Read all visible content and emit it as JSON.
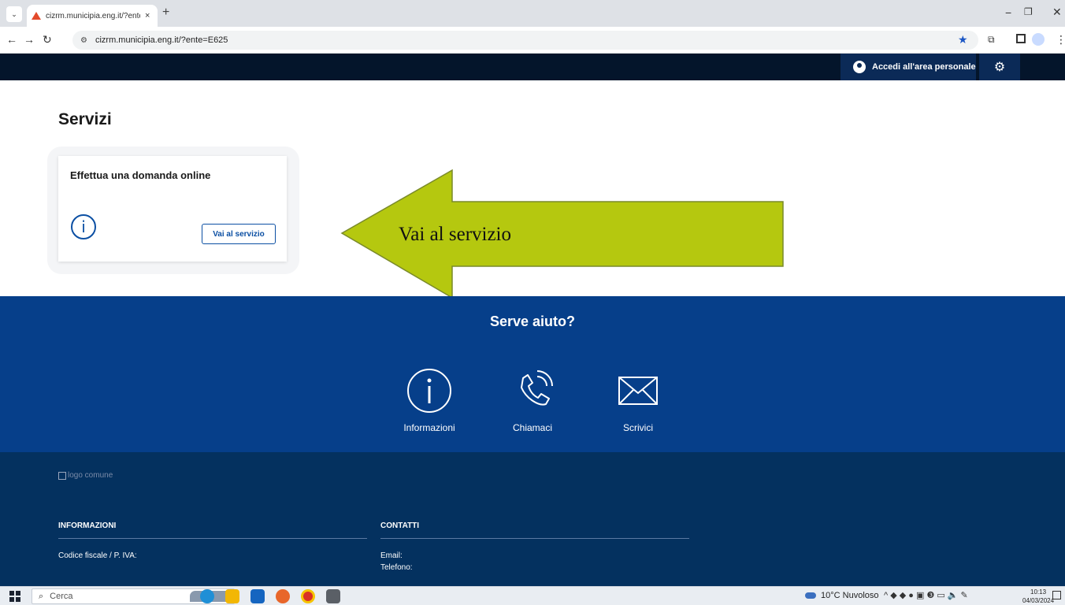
{
  "browser": {
    "tab_title": "cizrm.municipia.eng.it/?ente=E6",
    "tab_close": "×",
    "new_tab": "+",
    "url": "cizrm.municipia.eng.it/?ente=E625",
    "minimize": "−",
    "restore": "❐",
    "close": "✕"
  },
  "header": {
    "login_label": "Accedi all'area personale",
    "settings_icon": "gear-icon"
  },
  "main": {
    "title": "Servizi",
    "card": {
      "title": "Effettua una domanda online",
      "info_icon": "i",
      "button_label": "Vai al servizio"
    },
    "callout": {
      "text": "Vai al servizio",
      "fill_color": "#b5c80f",
      "stroke_color": "#7a8a2a"
    }
  },
  "help": {
    "title": "Serve aiuto?",
    "items": [
      {
        "label": "Informazioni",
        "icon": "info-icon"
      },
      {
        "label": "Chiamaci",
        "icon": "phone-icon"
      },
      {
        "label": "Scrivici",
        "icon": "mail-icon"
      }
    ]
  },
  "footer": {
    "logo_alt": "logo comune",
    "informazioni": {
      "heading": "INFORMAZIONI",
      "lines": [
        "Codice fiscale / P. IVA:"
      ]
    },
    "contatti": {
      "heading": "CONTATTI",
      "lines": [
        "Email:",
        "Telefono:"
      ]
    }
  },
  "taskbar": {
    "search_label": "Cerca",
    "weather": "10°C  Nuvoloso",
    "time": "10:13",
    "date": "04/03/2024"
  },
  "colors": {
    "header_bg": "#04152b",
    "help_bg": "#063f8a",
    "footer_bg": "#04315f",
    "primary": "#0b4fa3"
  }
}
